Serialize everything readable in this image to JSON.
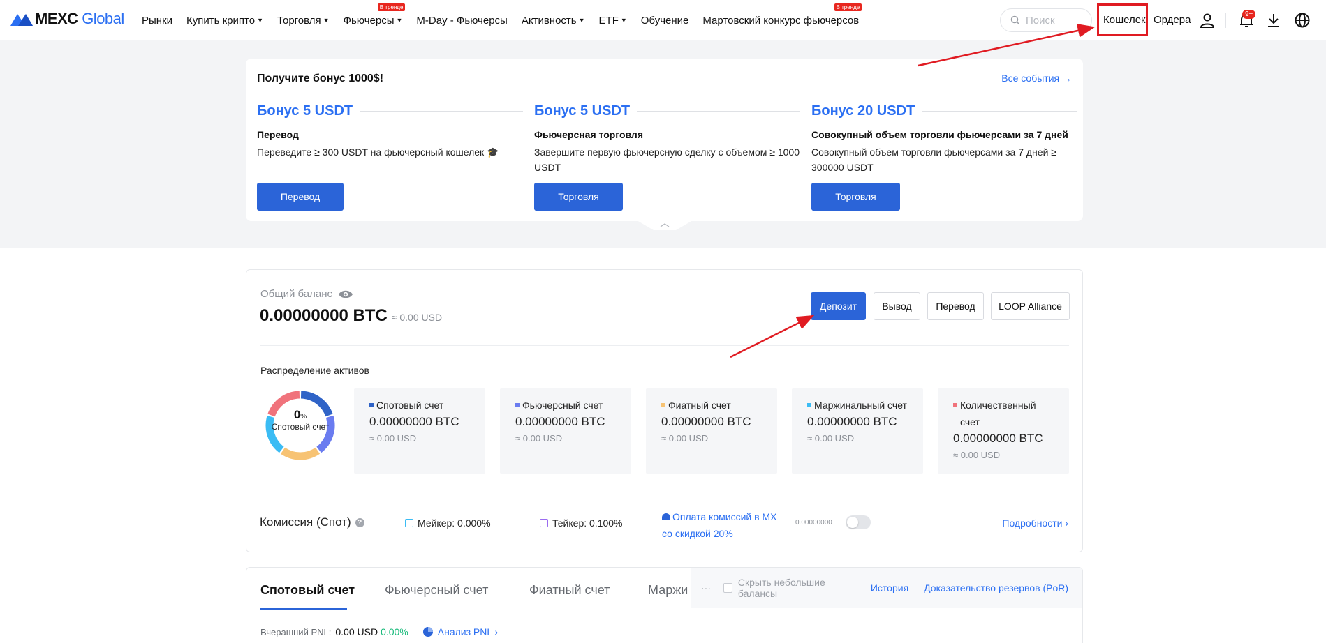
{
  "header": {
    "logo_brand": "MEXC",
    "logo_suffix": "Global",
    "nav": [
      {
        "label": "Рынки",
        "dropdown": false
      },
      {
        "label": "Купить крипто",
        "dropdown": true
      },
      {
        "label": "Торговля",
        "dropdown": true
      },
      {
        "label": "Фьючерсы",
        "dropdown": true,
        "badge": "В тренде"
      },
      {
        "label": "M-Day - Фьючерсы",
        "dropdown": false
      },
      {
        "label": "Активность",
        "dropdown": true
      },
      {
        "label": "ETF",
        "dropdown": true
      },
      {
        "label": "Обучение",
        "dropdown": false
      },
      {
        "label": "Мартовский конкурс фьючерсов",
        "dropdown": false,
        "badge": "В тренде"
      }
    ],
    "search_placeholder": "Поиск",
    "wallet_label": "Кошелек",
    "orders_label": "Ордера",
    "notifications_badge": "9+"
  },
  "promo": {
    "title": "Получите бонус 1000$!",
    "all_events": "Все события →",
    "bonuses": [
      {
        "amount": "Бонус 5 USDT",
        "name": "Перевод",
        "desc": "Переведите ≥ 300 USDT на фьючерсный кошелек 🎓",
        "button": "Перевод"
      },
      {
        "amount": "Бонус 5 USDT",
        "name": "Фьючерсная торговля",
        "desc": "Завершите первую фьючерсную сделку с объемом ≥ 1000 USDT",
        "button": "Торговля"
      },
      {
        "amount": "Бонус 20 USDT",
        "name": "Совокупный объем торговли фьючерсами за 7 дней",
        "desc": "Совокупный объем торговли фьючерсами за 7 дней ≥ 300000 USDT",
        "button": "Торговля"
      }
    ]
  },
  "balance": {
    "label": "Общий баланс",
    "btc": "0.00000000 BTC",
    "usd": "≈ 0.00 USD",
    "actions": [
      "Депозит",
      "Вывод",
      "Перевод",
      "LOOP Alliance"
    ],
    "allocation_label": "Распределение активов",
    "donut_pct": "0",
    "donut_pct_unit": "%",
    "donut_caption": "Спотовый счет",
    "accounts": [
      {
        "name": "Спотовый счет",
        "btc": "0.00000000 BTC",
        "usd": "≈ 0.00 USD",
        "color": "#2f63c7",
        "share": 0.2
      },
      {
        "name": "Фьючерсный счет",
        "btc": "0.00000000 BTC",
        "usd": "≈ 0.00 USD",
        "color": "#6a7cf0",
        "share": 0.2
      },
      {
        "name": "Фиатный счет",
        "btc": "0.00000000 BTC",
        "usd": "≈ 0.00 USD",
        "color": "#f7c374",
        "share": 0.2
      },
      {
        "name": "Маржинальный счет",
        "btc": "0.00000000 BTC",
        "usd": "≈ 0.00 USD",
        "color": "#3bbcf4",
        "share": 0.2
      },
      {
        "name": "Количественный счет",
        "btc": "0.00000000 BTC",
        "usd": "≈ 0.00 USD",
        "color": "#f0737c",
        "share": 0.2
      }
    ]
  },
  "fees": {
    "title": "Комиссия (Спот)",
    "maker": "Мейкер:  0.000%",
    "taker": "Тейкер:  0.100%",
    "mx_discount": "Оплата комиссий в MX со скидкой 20%",
    "mx_balance": "0.00000000",
    "details": "Подробности ›"
  },
  "tabs": {
    "items": [
      "Спотовый счет",
      "Фьючерсный счет",
      "Фиатный счет",
      "Маржи"
    ],
    "more": "···",
    "hide_small": "Скрыть небольшие балансы",
    "history": "История",
    "por": "Доказательство резервов (PoR)",
    "pnl_label": "Вчерашний PNL:",
    "pnl_value": "0.00 USD",
    "pnl_pct": "0.00%",
    "pnl_analysis": "Анализ PNL ›"
  },
  "colors": {
    "accent": "#2b64d8",
    "link": "#2b6ff2",
    "annotation": "#e01b22",
    "positive": "#16b979"
  }
}
